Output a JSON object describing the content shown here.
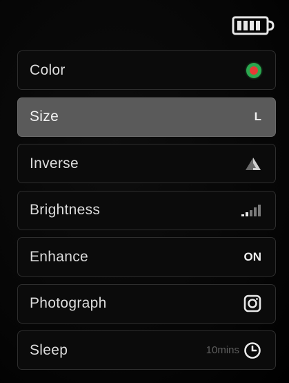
{
  "status": {
    "battery_icon": "battery-full-icon",
    "battery_level": 1.0
  },
  "menu": {
    "items": [
      {
        "label": "Color",
        "value_icon": "color-dot-icon",
        "colors": {
          "ring": "#2aa84f",
          "center": "#e53935"
        }
      },
      {
        "label": "Size",
        "value": "L",
        "selected": true
      },
      {
        "label": "Inverse",
        "value_icon": "inverse-triangle-icon"
      },
      {
        "label": "Brightness",
        "value_icon": "signal-bars-icon",
        "level": 0.2
      },
      {
        "label": "Enhance",
        "value": "ON"
      },
      {
        "label": "Photograph",
        "value_icon": "camera-icon"
      },
      {
        "label": "Sleep",
        "value": "10mins",
        "value_icon": "clock-icon"
      }
    ]
  },
  "colors": {
    "background": "#000000",
    "selected_background": "#5a5a5a",
    "item_border": "#2e2e2e"
  }
}
